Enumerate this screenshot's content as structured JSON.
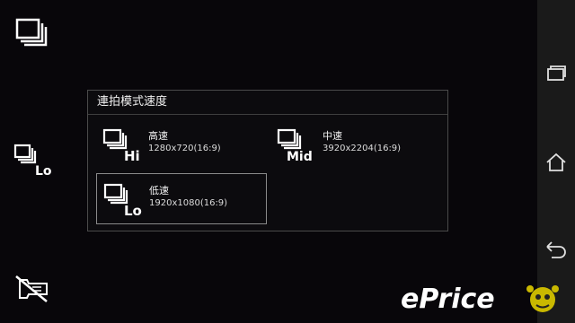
{
  "left_controls": {
    "burst_icon": "burst-mode-icon",
    "speed_icon": "burst-low-speed-icon",
    "speed_badge": "Lo",
    "flash_icon": "flash-off-icon"
  },
  "dialog": {
    "title": "連拍模式速度",
    "options": [
      {
        "name": "高速",
        "resolution": "1280x720(16:9)",
        "badge": "Hi",
        "selected": false
      },
      {
        "name": "中速",
        "resolution": "3920x2204(16:9)",
        "badge": "Mid",
        "selected": false
      },
      {
        "name": "低速",
        "resolution": "1920x1080(16:9)",
        "badge": "Lo",
        "selected": true
      }
    ]
  },
  "nav": {
    "recent_icon": "recent-apps-icon",
    "home_icon": "home-icon",
    "back_icon": "back-icon"
  },
  "watermark": {
    "text": "ePrice"
  }
}
